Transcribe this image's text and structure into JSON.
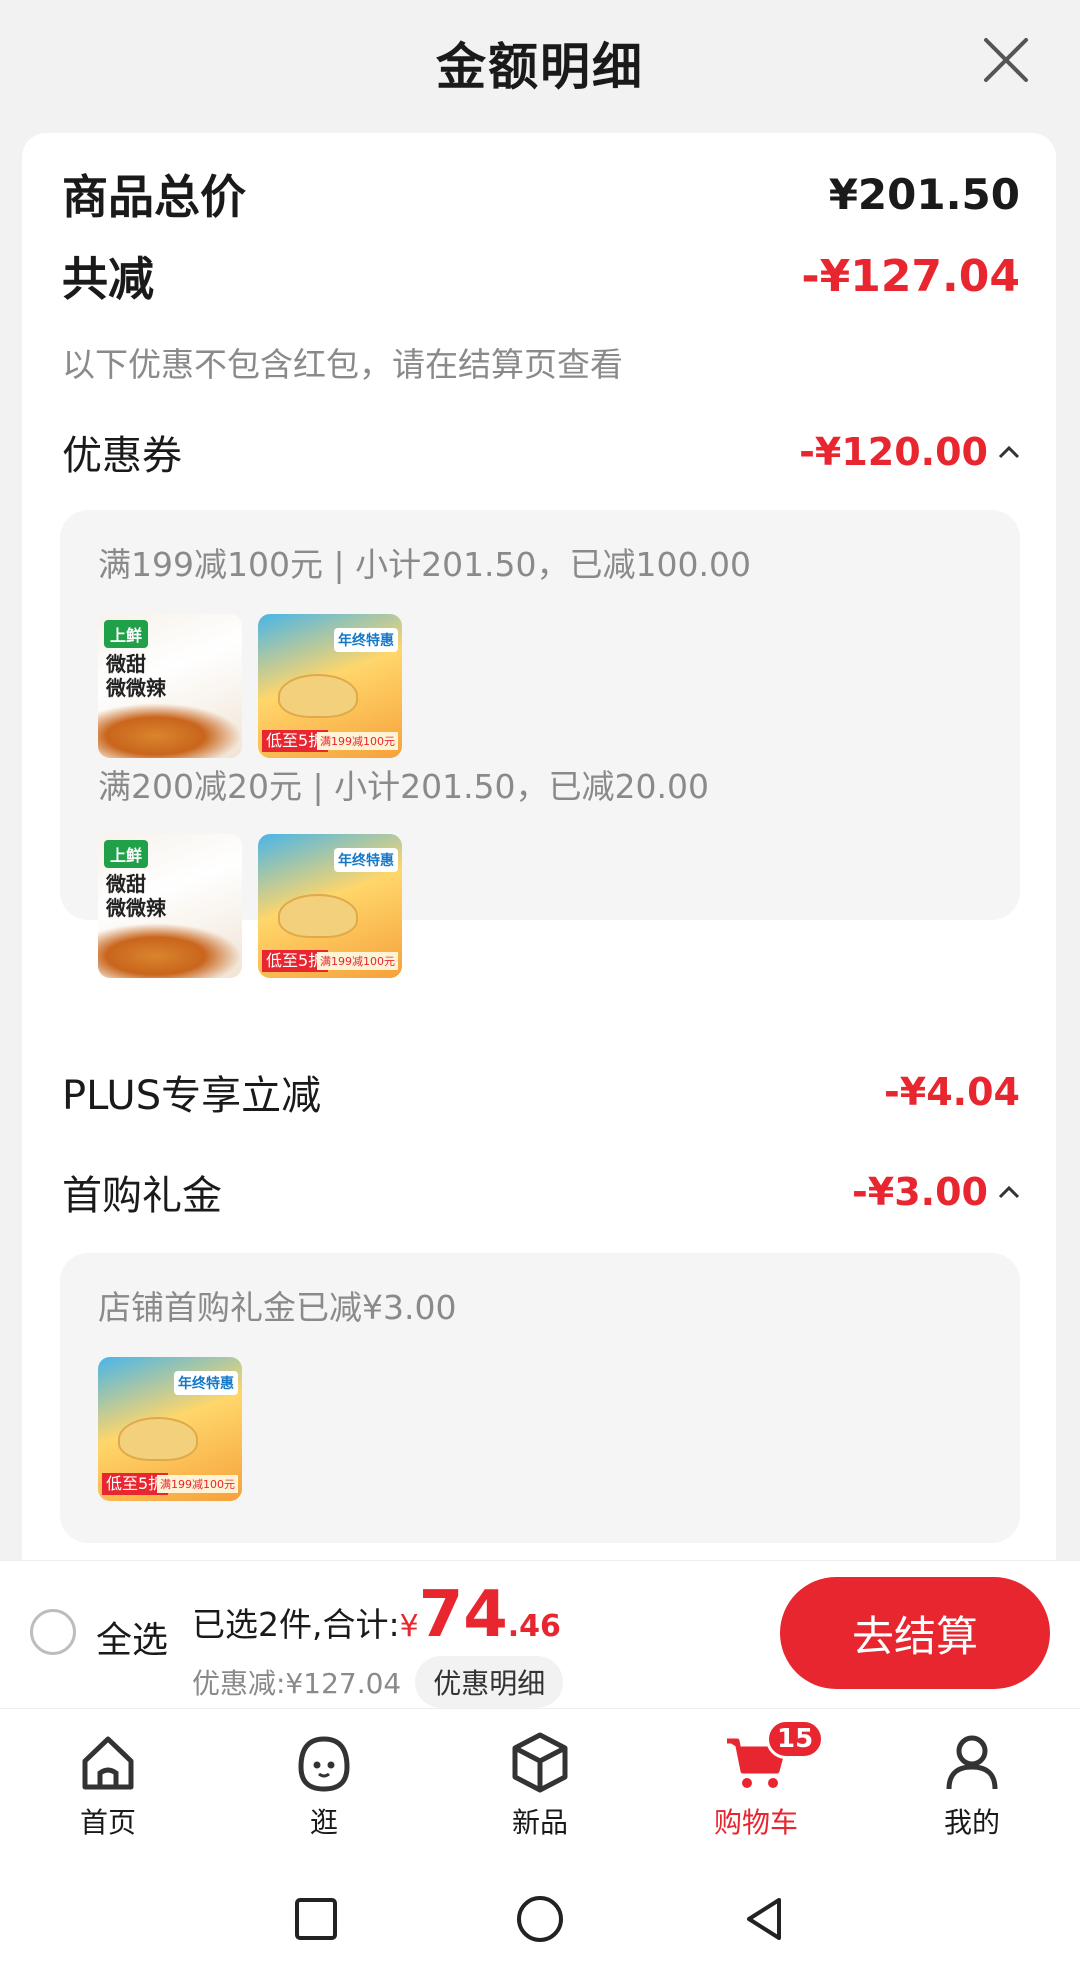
{
  "sheet": {
    "title": "金额明细"
  },
  "summary": {
    "total_label": "商品总价",
    "total_value": "¥201.50",
    "reduce_label": "共减",
    "reduce_value": "-¥127.04",
    "note": "以下优惠不包含红包，请在结算页查看"
  },
  "coupon": {
    "label": "优惠券",
    "value": "-¥120.00",
    "groups": [
      {
        "line": "满199减100元 | 小计201.50，已减100.00"
      },
      {
        "line": "满200减20元 | 小计201.50，已减20.00"
      }
    ]
  },
  "thumb_text": {
    "fry_brand": "上鲜",
    "fry_word1": "微甜",
    "fry_word2": "微微辣",
    "dump_label": "年终特惠",
    "dump_tag": "低至5折",
    "dump_promo": "满199减100元"
  },
  "plus": {
    "label": "PLUS专享立减",
    "value": "-¥4.04"
  },
  "first_gift": {
    "label": "首购礼金",
    "value": "-¥3.00",
    "line": "店铺首购礼金已减¥3.00"
  },
  "checkout": {
    "select_all": "全选",
    "summary_prefix": "已选2件,合计:",
    "currency": "¥",
    "amount_int": "74",
    "amount_dec": ".46",
    "discount_text": "优惠减:¥127.04",
    "discount_detail": "优惠明细",
    "button": "去结算"
  },
  "tabs": [
    {
      "label": "首页",
      "icon": "home-icon"
    },
    {
      "label": "逛",
      "icon": "browse-face-icon"
    },
    {
      "label": "新品",
      "icon": "cube-icon"
    },
    {
      "label": "购物车",
      "icon": "cart-icon",
      "badge": "15",
      "active": true
    },
    {
      "label": "我的",
      "icon": "user-icon"
    }
  ],
  "colors": {
    "accent": "#e8262f",
    "muted": "#8a8a8a",
    "panel": "#f5f5f5"
  }
}
